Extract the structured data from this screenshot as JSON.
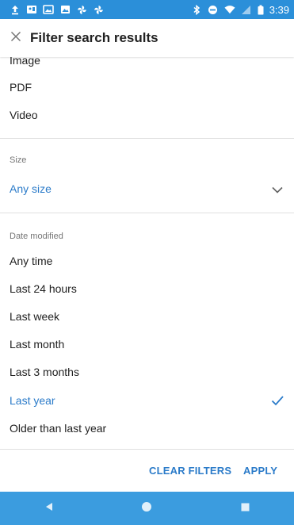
{
  "colors": {
    "status_bar": "#2b8fd9",
    "nav_bar": "#3b9cdf",
    "accent": "#2b7bc9",
    "text": "#212121",
    "muted": "#757575",
    "divider": "#e0e0e0"
  },
  "status_bar": {
    "icons_left": [
      "upload-icon",
      "photo-icon",
      "gallery-icon",
      "image-icon",
      "pinwheel-icon",
      "pinwheel-icon"
    ],
    "icons_right": [
      "bluetooth-icon",
      "do-not-disturb-icon",
      "wifi-icon",
      "no-signal-icon",
      "battery-icon"
    ],
    "time": "3:39"
  },
  "app_bar": {
    "title": "Filter search results",
    "close_icon": "close-icon"
  },
  "file_type": {
    "items": [
      "Image",
      "PDF",
      "Video"
    ]
  },
  "size": {
    "label": "Size",
    "value": "Any size",
    "icon": "chevron-down-icon"
  },
  "date_modified": {
    "label": "Date modified",
    "options": [
      "Any time",
      "Last 24 hours",
      "Last week",
      "Last month",
      "Last 3 months",
      "Last year",
      "Older than last year"
    ],
    "selected": "Last year",
    "check_icon": "checkmark-icon"
  },
  "footer": {
    "clear_label": "CLEAR FILTERS",
    "apply_label": "APPLY"
  },
  "nav_bar": {
    "icons": [
      "back-icon",
      "home-icon",
      "recents-icon"
    ]
  }
}
